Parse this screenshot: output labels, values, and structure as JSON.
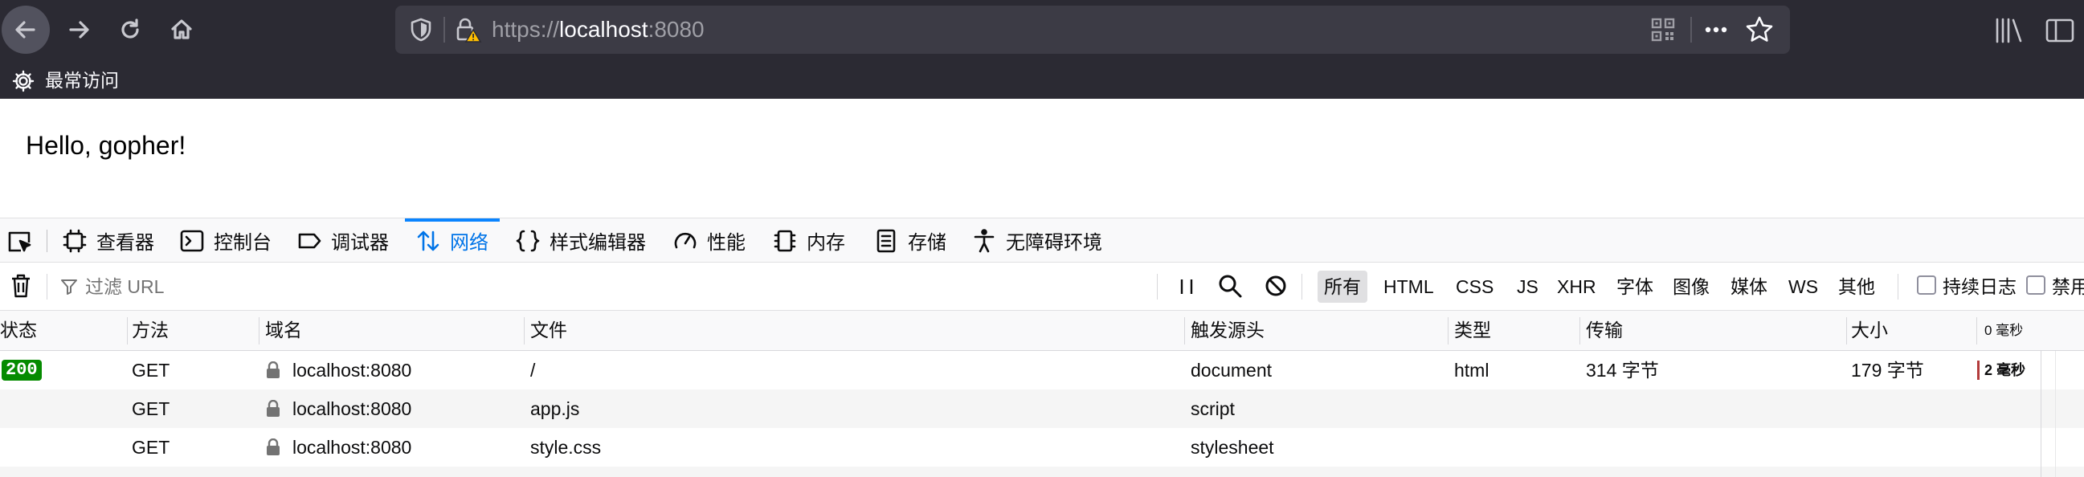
{
  "browser": {
    "url_scheme": "https://",
    "url_host": "localhost",
    "url_port": ":8080",
    "bookmarks_label": "最常访问"
  },
  "page": {
    "greeting": "Hello, gopher!"
  },
  "devtools": {
    "tabs": [
      {
        "label": "查看器",
        "icon": "inspector-icon"
      },
      {
        "label": "控制台",
        "icon": "console-icon"
      },
      {
        "label": "调试器",
        "icon": "debugger-icon"
      },
      {
        "label": "网络",
        "icon": "network-icon",
        "active": true
      },
      {
        "label": "样式编辑器",
        "icon": "style-editor-icon"
      },
      {
        "label": "性能",
        "icon": "performance-icon"
      },
      {
        "label": "内存",
        "icon": "memory-icon"
      },
      {
        "label": "存储",
        "icon": "storage-icon"
      },
      {
        "label": "无障碍环境",
        "icon": "accessibility-icon"
      }
    ],
    "filter_placeholder": "过滤 URL",
    "type_filters": [
      "所有",
      "HTML",
      "CSS",
      "JS",
      "XHR",
      "字体",
      "图像",
      "媒体",
      "WS",
      "其他"
    ],
    "active_type_filter": "所有",
    "persist_logs_label": "持续日志",
    "disable_cache_label": "禁用",
    "columns": {
      "status": "状态",
      "method": "方法",
      "domain": "域名",
      "file": "文件",
      "initiator": "触发源头",
      "type": "类型",
      "transferred": "传输",
      "size": "大小",
      "waterfall": "0 毫秒"
    },
    "requests": [
      {
        "status": "200",
        "method": "GET",
        "domain": "localhost:8080",
        "file": "/",
        "initiator": "document",
        "type": "html",
        "transferred": "314 字节",
        "size": "179 字节",
        "timing": "2 毫秒"
      },
      {
        "status": "",
        "method": "GET",
        "domain": "localhost:8080",
        "file": "app.js",
        "initiator": "script",
        "type": "",
        "transferred": "",
        "size": "",
        "timing": ""
      },
      {
        "status": "",
        "method": "GET",
        "domain": "localhost:8080",
        "file": "style.css",
        "initiator": "stylesheet",
        "type": "",
        "transferred": "",
        "size": "",
        "timing": ""
      }
    ]
  },
  "colors": {
    "toolbar_bg": "#2b2a33",
    "active_tab": "#0074e8",
    "status_ok": "#058b00"
  }
}
